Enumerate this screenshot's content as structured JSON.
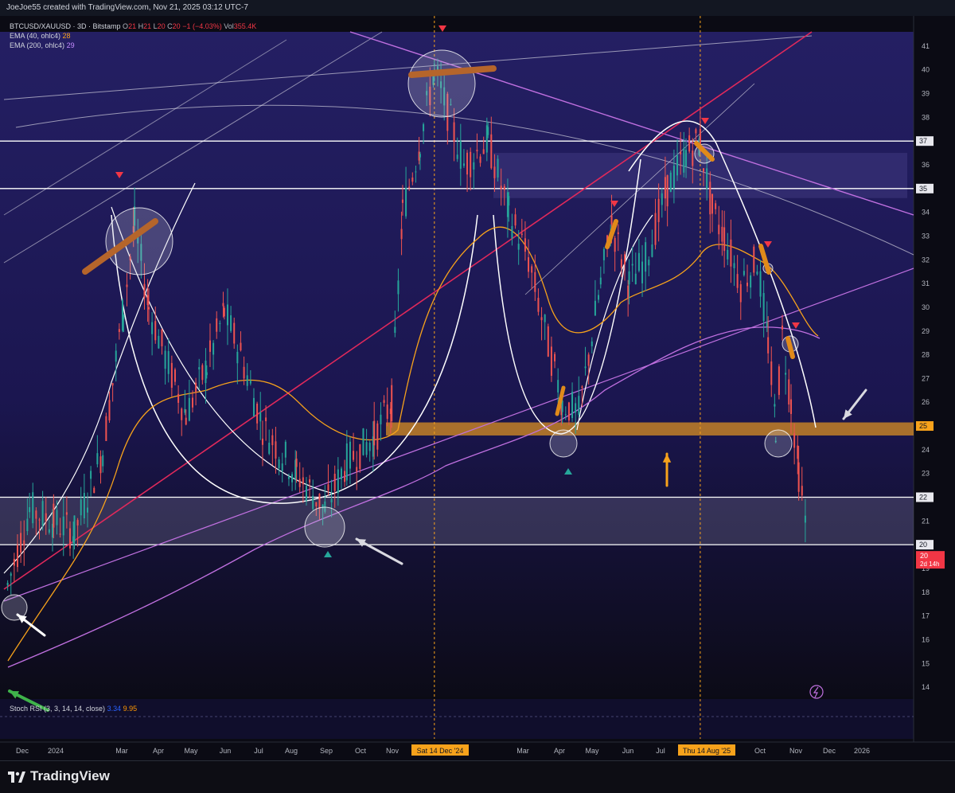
{
  "header": {
    "attribution": "JoeJoe55 created with TradingView.com, Nov 21, 2025 03:12 UTC-7"
  },
  "legend": {
    "symbol": "BTCUSD/XAUUSD · 3D · Bitstamp",
    "o_label": "O",
    "o_value": "21",
    "h_label": "H",
    "h_value": "21",
    "l_label": "L",
    "l_value": "20",
    "c_label": "C",
    "c_value": "20",
    "change": "−1 (−4.03%)",
    "vol_label": "Vol",
    "vol_value": "355.4K",
    "ema40_label": "EMA (40, ohlc4)",
    "ema40_value": "28",
    "ema200_label": "EMA (200, ohlc4)",
    "ema200_value": "29"
  },
  "rsi_legend": {
    "label": "Stoch RSI (3, 3, 14, 14, close)",
    "k_value": "3.34",
    "d_value": "9.95"
  },
  "footer": {
    "brand": "TradingView"
  },
  "colors": {
    "up": "#26a69a",
    "down": "#ef5350",
    "ema40": "#f7a21b",
    "ema200": "#c070e0",
    "trendline_red": "#e0295b",
    "support_orange": "#f7a21b",
    "white_line": "#ffffff"
  },
  "chart_data": {
    "type": "candlestick",
    "title": "BTCUSD/XAUUSD · 3D · Bitstamp",
    "ylim": [
      13.6,
      41.6
    ],
    "y_ticks": [
      14,
      15,
      16,
      17,
      18,
      19,
      20,
      21,
      22,
      23,
      24,
      25,
      26,
      27,
      28,
      29,
      30,
      31,
      32,
      33,
      34,
      35,
      36,
      37,
      38,
      39,
      40,
      41
    ],
    "x_ticks": [
      "Dec",
      "2024",
      "Mar",
      "Apr",
      "May",
      "Jun",
      "Jul",
      "Aug",
      "Sep",
      "Oct",
      "Nov",
      "Sat 14 Dec '24",
      "Mar",
      "Apr",
      "May",
      "Jun",
      "Jul",
      "Thu 14 Aug '25",
      "Oct",
      "Nov",
      "Dec",
      "2026"
    ],
    "highlighted_dates": [
      "Sat 14 Dec '24",
      "Thu 14 Aug '25"
    ],
    "horizontal_levels": [
      {
        "value": 37,
        "label": "37",
        "color": "#ffffff"
      },
      {
        "value": 35,
        "label": "35",
        "color": "#ffffff"
      },
      {
        "value": 25,
        "label": "25",
        "color": "#f7a21b"
      },
      {
        "value": 22,
        "label": "22",
        "color": "#ffffff"
      },
      {
        "value": 20,
        "label": "20",
        "color": "#ffffff"
      }
    ],
    "last_price": {
      "value": 20,
      "label": "20",
      "countdown": "2d 14h"
    },
    "price_path": [
      [
        "2023-11-20",
        18.3
      ],
      [
        "2023-12-10",
        21.5
      ],
      [
        "2024-01-01",
        21
      ],
      [
        "2024-01-20",
        20.5
      ],
      [
        "2024-02-15",
        24
      ],
      [
        "2024-03-05",
        30
      ],
      [
        "2024-03-15",
        33.5
      ],
      [
        "2024-03-28",
        30
      ],
      [
        "2024-04-15",
        27.5
      ],
      [
        "2024-05-01",
        25.5
      ],
      [
        "2024-05-20",
        27.5
      ],
      [
        "2024-06-05",
        29.8
      ],
      [
        "2024-06-20",
        28
      ],
      [
        "2024-07-10",
        25
      ],
      [
        "2024-07-25",
        24
      ],
      [
        "2024-08-10",
        23
      ],
      [
        "2024-09-05",
        21.5
      ],
      [
        "2024-09-25",
        23.5
      ],
      [
        "2024-10-20",
        24.5
      ],
      [
        "2024-11-05",
        26
      ],
      [
        "2024-11-15",
        34
      ],
      [
        "2024-12-01",
        37
      ],
      [
        "2024-12-14",
        40
      ],
      [
        "2025-01-10",
        36
      ],
      [
        "2025-02-01",
        37
      ],
      [
        "2025-02-20",
        34
      ],
      [
        "2025-03-10",
        32
      ],
      [
        "2025-03-25",
        29
      ],
      [
        "2025-04-10",
        26
      ],
      [
        "2025-04-25",
        25.5
      ],
      [
        "2025-05-15",
        31
      ],
      [
        "2025-05-25",
        33.5
      ],
      [
        "2025-06-10",
        31
      ],
      [
        "2025-06-25",
        32
      ],
      [
        "2025-07-15",
        35
      ],
      [
        "2025-08-01",
        36.5
      ],
      [
        "2025-08-14",
        37
      ],
      [
        "2025-08-25",
        34
      ],
      [
        "2025-09-05",
        33
      ],
      [
        "2025-09-20",
        31
      ],
      [
        "2025-10-05",
        32
      ],
      [
        "2025-10-15",
        28.5
      ],
      [
        "2025-10-22",
        25
      ],
      [
        "2025-10-28",
        28.8
      ],
      [
        "2025-11-05",
        26
      ],
      [
        "2025-11-12",
        23
      ],
      [
        "2025-11-21",
        20
      ]
    ]
  }
}
